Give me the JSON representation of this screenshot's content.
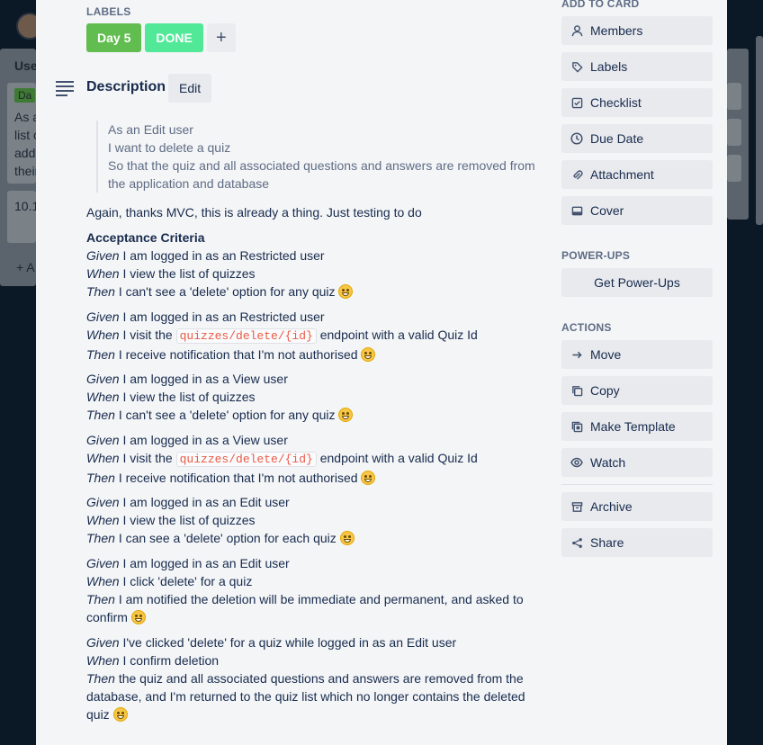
{
  "background": {
    "list_title": "Use",
    "card_label": "Da",
    "card_lines": [
      "As a",
      "list o",
      "add",
      "their"
    ],
    "card2_title": "10.1",
    "add_card": "+ A"
  },
  "labels": {
    "title": "LABELS",
    "items": [
      {
        "text": "Day 5",
        "color": "#61bd4f"
      },
      {
        "text": "DONE",
        "color": "#51e898"
      }
    ],
    "add": "+"
  },
  "description": {
    "title": "Description",
    "edit": "Edit",
    "quote": [
      "As an Edit user",
      "I want to delete a quiz",
      "So that the quiz and all associated questions and answers are removed from the application and database"
    ],
    "intro": "Again, thanks MVC, this is already a thing. Just testing to do",
    "criteria_heading": "Acceptance Criteria",
    "scenarios": [
      {
        "given": "I am logged in as an Restricted user",
        "when": "I view the list of quizzes",
        "then": "I can't see a 'delete' option for any quiz"
      },
      {
        "given": "I am logged in as an Restricted user",
        "when_pre": "I visit the",
        "when_code": "quizzes/delete/{id}",
        "when_post": "endpoint with a valid Quiz Id",
        "then": "I receive notification that I'm not authorised"
      },
      {
        "given": "I am logged in as a View user",
        "when": "I view the list of quizzes",
        "then": "I can't see a 'delete' option for any quiz"
      },
      {
        "given": "I am logged in as a View user",
        "when_pre": "I visit the",
        "when_code": "quizzes/delete/{id}",
        "when_post": "endpoint with a valid Quiz Id",
        "then": "I receive notification that I'm not authorised"
      },
      {
        "given": "I am logged in as an Edit user",
        "when": "I view the list of quizzes",
        "then": "I can see a 'delete' option for each quiz"
      },
      {
        "given": "I am logged in as an Edit user",
        "when": "I click 'delete' for a quiz",
        "then": "I am notified the deletion will be immediate and permanent, and asked to",
        "then_cont": "confirm"
      },
      {
        "given": "I've clicked 'delete' for a quiz while logged in as an Edit user",
        "when": "I confirm deletion",
        "then": "the quiz and all associated questions and answers are removed from the",
        "then_cont": "database, and I'm returned to the quiz list which no longer contains the deleted",
        "then_cont2": "quiz"
      }
    ],
    "kw": {
      "given": "Given",
      "when": "When",
      "then": "Then"
    }
  },
  "sidebar": {
    "add_to_card": "ADD TO CARD",
    "add_items": [
      {
        "label": "Members",
        "icon": "person-icon"
      },
      {
        "label": "Labels",
        "icon": "tag-icon"
      },
      {
        "label": "Checklist",
        "icon": "checklist-icon"
      },
      {
        "label": "Due Date",
        "icon": "clock-icon"
      },
      {
        "label": "Attachment",
        "icon": "paperclip-icon"
      },
      {
        "label": "Cover",
        "icon": "cover-icon"
      }
    ],
    "power_ups": "POWER-UPS",
    "get_power_ups": "Get Power-Ups",
    "actions": "ACTIONS",
    "action_items": [
      {
        "label": "Move",
        "icon": "arrow-right-icon"
      },
      {
        "label": "Copy",
        "icon": "copy-icon"
      },
      {
        "label": "Make Template",
        "icon": "template-icon"
      },
      {
        "label": "Watch",
        "icon": "eye-icon"
      }
    ],
    "archive": "Archive",
    "share": "Share"
  }
}
